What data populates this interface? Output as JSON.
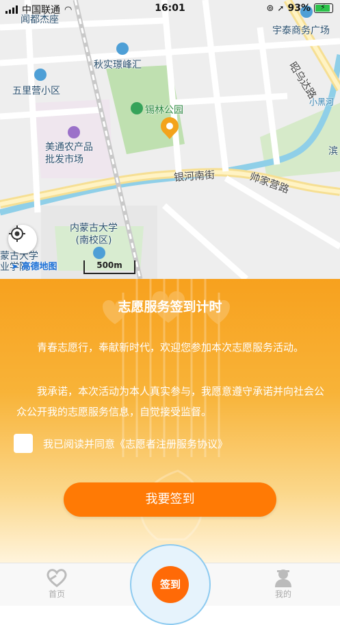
{
  "status_bar": {
    "carrier": "中国联通",
    "time": "16:01",
    "battery": "93%"
  },
  "map": {
    "labels": {
      "poi1": "闻都杰座",
      "poi2": "宇泰商务广场",
      "poi3": "秋实璟峰汇",
      "poi4": "昭乌达路",
      "poi5": "五里营小区",
      "poi6": "锡林公园",
      "poi7": "小黑河",
      "poi8": "美通农产品\n批发市场",
      "poi9": "滨",
      "poi10": "银河南街",
      "poi11": "帅家营路",
      "poi12": "内蒙古大学\n(南校区)",
      "poi13": "蒙古大学\n业学院"
    },
    "logo": "高德地图",
    "scale": "500m"
  },
  "panel": {
    "title": "志愿服务签到计时",
    "para1": "青春志愿行，奉献新时代，欢迎您参加本次志愿服务活动。",
    "para2": "我承诺，本次活动为本人真实参与，我愿意遵守承诺并向社会公众公开我的志愿服务信息，自觉接受监督。",
    "agree": "我已阅读并同意《志愿者注册服务协议》",
    "checkin_button": "我要签到"
  },
  "tabbar": {
    "home": "首页",
    "center": "签到",
    "mine": "我的"
  }
}
